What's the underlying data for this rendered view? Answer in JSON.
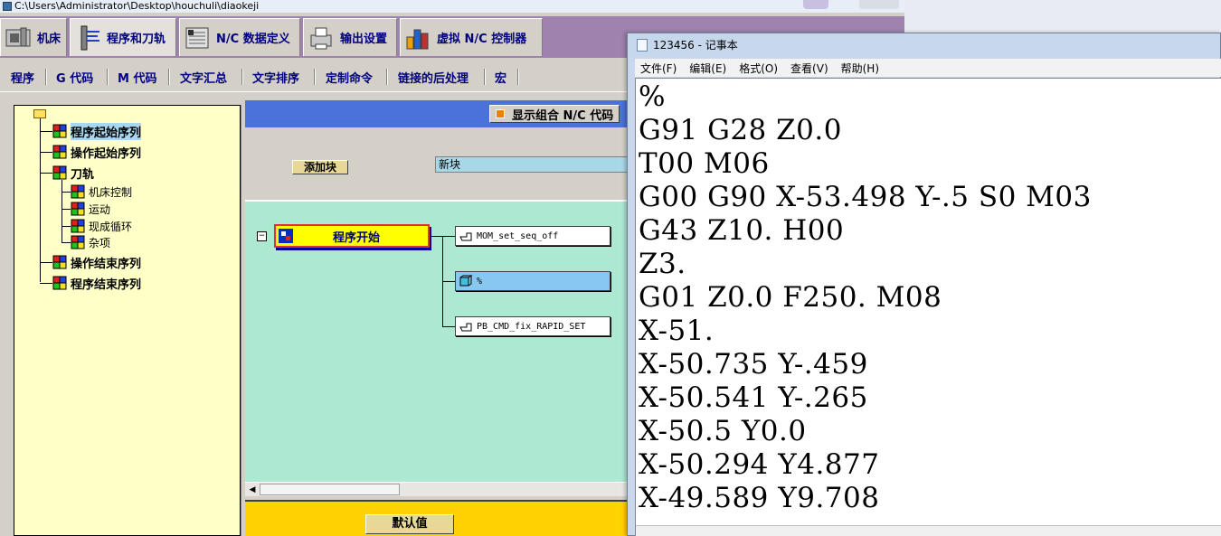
{
  "pb": {
    "title": "C:\\Users\\Administrator\\Desktop\\houchuli\\diaokeji",
    "main_tabs": [
      "机床",
      "程序和刀轨",
      "N/C 数据定义",
      "输出设置",
      "虚拟 N/C 控制器"
    ],
    "sub_tabs": [
      "程序",
      "G 代码",
      "M 代码",
      "文字汇总",
      "文字排序",
      "定制命令",
      "链接的后处理",
      "宏"
    ],
    "tree": {
      "items": [
        "程序起始序列",
        "操作起始序列",
        "刀轨",
        "机床控制",
        "运动",
        "现成循环",
        "杂项",
        "操作结束序列",
        "程序结束序列"
      ]
    },
    "combo_label": "显示组合 N/C 代码",
    "add_block_label": "添加块",
    "new_block_value": "新块",
    "block_title": "程序开始",
    "commands": [
      "MOM_set_seq_off",
      "%",
      "PB_CMD_fix_RAPID_SET"
    ],
    "default_button": "默认值"
  },
  "notepad": {
    "title": "123456 - 记事本",
    "menus": [
      "文件(F)",
      "编辑(E)",
      "格式(O)",
      "查看(V)",
      "帮助(H)"
    ],
    "lines": [
      "%",
      "G91 G28 Z0.0",
      "T00 M06",
      "G00 G90 X-53.498 Y-.5 S0 M03",
      "G43 Z10. H00",
      "Z3.",
      "G01 Z0.0 F250. M08",
      "X-51.",
      "X-50.735 Y-.459",
      "X-50.541 Y-.265",
      "X-50.5 Y0.0",
      "X-50.294 Y4.877",
      "X-49.589 Y9.708"
    ]
  },
  "colors": {
    "tab_strip": "#9f82ad",
    "tab_text": "#000080",
    "tree_bg": "#ffffc8",
    "canvas_bg": "#ade8d2",
    "blue_bar": "#4a72d8",
    "block_yellow": "#ffff00",
    "footer_yellow": "#ffd200"
  }
}
